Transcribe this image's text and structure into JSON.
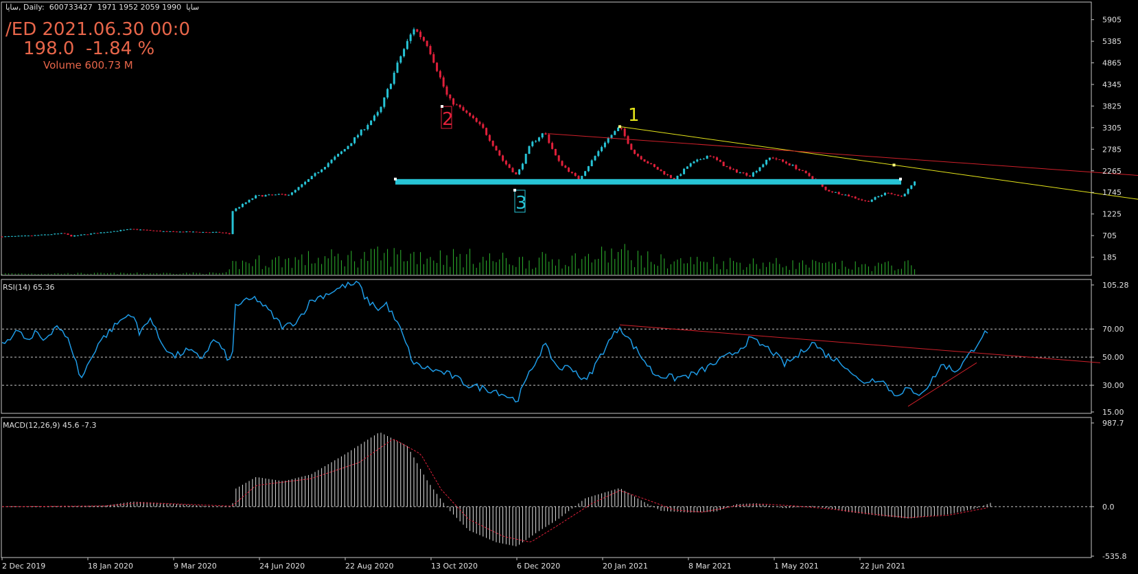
{
  "header": {
    "main_title": "ساپا, Daily:  600733427  1971 1952 2059 1990  ساپا",
    "rsi_title": "RSI(14) 65.36",
    "macd_title": "MACD(12,26,9) 45.6 -7.3"
  },
  "info": {
    "line1": "/ED 2021.06.30 00:0",
    "line2": "198.0  -1.84 %",
    "line3": "Volume 600.73 M"
  },
  "colors": {
    "background": "#000000",
    "frame": "#c8c8c8",
    "bull": "#27c4d6",
    "bear": "#e0203a",
    "volume": "#2fb82f",
    "rsi_line": "#1e9be6",
    "macd_hist": "#e6e6e6",
    "macd_signal": "#e0203a",
    "support": "#27c4d6",
    "trend_yellow": "#e6e61a",
    "trend_red": "#d0202a",
    "label1": "#e6e61a",
    "label2": "#e0203a",
    "label3": "#27c4d6"
  },
  "chart_data": [
    {
      "type": "candlestick",
      "ylim": [
        -120,
        6230
      ],
      "y_ticks": [
        "5905",
        "5385",
        "4865",
        "4345",
        "3825",
        "3305",
        "2785",
        "2265",
        "1745",
        "1225",
        "705",
        "185"
      ],
      "x_ticks": [
        "2 Dec 2019",
        "18 Jan 2020",
        "9 Mar 2020",
        "24 Jun 2020",
        "22 Aug 2020",
        "13 Oct 2020",
        "6 Dec 2020",
        "20 Jan 2021",
        "8 Mar 2021",
        "1 May 2021",
        "22 Jun 2021"
      ],
      "price_path": [
        [
          0,
          680
        ],
        [
          0.04,
          700
        ],
        [
          0.09,
          760
        ],
        [
          0.1,
          690
        ],
        [
          0.15,
          790
        ],
        [
          0.19,
          860
        ],
        [
          0.24,
          800
        ],
        [
          0.29,
          790
        ],
        [
          0.32,
          780
        ],
        [
          0.335,
          730
        ],
        [
          0.335,
          1290
        ],
        [
          0.37,
          1660
        ],
        [
          0.42,
          1700
        ],
        [
          0.45,
          2100
        ],
        [
          0.5,
          2800
        ],
        [
          0.55,
          3700
        ],
        [
          0.58,
          5000
        ],
        [
          0.6,
          5700
        ],
        [
          0.62,
          5300
        ],
        [
          0.65,
          4000
        ],
        [
          0.68,
          3600
        ],
        [
          0.7,
          3300
        ],
        [
          0.73,
          2500
        ],
        [
          0.75,
          2150
        ],
        [
          0.77,
          2900
        ],
        [
          0.79,
          3200
        ],
        [
          0.81,
          2500
        ],
        [
          0.84,
          2050
        ],
        [
          0.88,
          3000
        ],
        [
          0.9,
          3320
        ],
        [
          0.92,
          2700
        ],
        [
          0.95,
          2350
        ],
        [
          0.98,
          2050
        ],
        [
          1.0,
          2400
        ],
        [
          1.03,
          2650
        ],
        [
          1.06,
          2300
        ],
        [
          1.09,
          2150
        ],
        [
          1.12,
          2600
        ],
        [
          1.15,
          2400
        ],
        [
          1.18,
          2100
        ],
        [
          1.2,
          1800
        ],
        [
          1.23,
          1680
        ],
        [
          1.26,
          1520
        ],
        [
          1.29,
          1750
        ],
        [
          1.31,
          1640
        ],
        [
          1.33,
          1990
        ]
      ],
      "volume_path": [
        [
          0,
          20
        ],
        [
          0.33,
          30
        ],
        [
          0.335,
          180
        ],
        [
          0.36,
          240
        ],
        [
          0.45,
          300
        ],
        [
          0.55,
          350
        ],
        [
          0.6,
          380
        ],
        [
          0.68,
          320
        ],
        [
          0.75,
          260
        ],
        [
          0.85,
          300
        ],
        [
          0.9,
          420
        ],
        [
          0.95,
          260
        ],
        [
          1.05,
          240
        ],
        [
          1.15,
          200
        ],
        [
          1.25,
          160
        ],
        [
          1.33,
          180
        ]
      ],
      "volume_ymax": 600,
      "support_level": 2000,
      "annotations": [
        {
          "label": "1",
          "color": "yellow"
        },
        {
          "label": "2",
          "color": "red"
        },
        {
          "label": "3",
          "color": "cyan"
        }
      ],
      "trendlines": [
        {
          "name": "yellow",
          "from": [
            0.9,
            3330
          ],
          "to": [
            1.75,
            1360
          ]
        },
        {
          "name": "red",
          "from": [
            0.795,
            3160
          ],
          "to": [
            1.83,
            1950
          ]
        }
      ]
    },
    {
      "type": "line",
      "name": "RSI(14) 65.36",
      "ylim": [
        10,
        105.28
      ],
      "y_ticks": [
        "105.28",
        "70.00",
        "50.00",
        "30.00",
        "15.00"
      ],
      "levels": [
        70,
        50,
        30
      ],
      "series": [
        [
          0,
          58
        ],
        [
          0.02,
          69
        ],
        [
          0.04,
          61
        ],
        [
          0.05,
          68
        ],
        [
          0.06,
          62
        ],
        [
          0.08,
          73
        ],
        [
          0.1,
          59
        ],
        [
          0.115,
          34
        ],
        [
          0.14,
          60
        ],
        [
          0.17,
          75
        ],
        [
          0.19,
          82
        ],
        [
          0.2,
          66
        ],
        [
          0.215,
          79
        ],
        [
          0.23,
          62
        ],
        [
          0.25,
          50
        ],
        [
          0.27,
          55
        ],
        [
          0.29,
          49
        ],
        [
          0.31,
          63
        ],
        [
          0.335,
          45
        ],
        [
          0.34,
          87
        ],
        [
          0.37,
          92
        ],
        [
          0.39,
          82
        ],
        [
          0.41,
          71
        ],
        [
          0.43,
          76
        ],
        [
          0.45,
          90
        ],
        [
          0.5,
          101
        ],
        [
          0.52,
          102
        ],
        [
          0.53,
          91
        ],
        [
          0.55,
          84
        ],
        [
          0.56,
          88
        ],
        [
          0.58,
          70
        ],
        [
          0.6,
          45
        ],
        [
          0.62,
          42
        ],
        [
          0.65,
          38
        ],
        [
          0.68,
          30
        ],
        [
          0.72,
          26
        ],
        [
          0.75,
          19
        ],
        [
          0.77,
          40
        ],
        [
          0.79,
          59
        ],
        [
          0.81,
          42
        ],
        [
          0.83,
          43
        ],
        [
          0.85,
          32
        ],
        [
          0.88,
          58
        ],
        [
          0.9,
          72
        ],
        [
          0.92,
          58
        ],
        [
          0.95,
          38
        ],
        [
          0.98,
          35
        ],
        [
          1.01,
          38
        ],
        [
          1.04,
          46
        ],
        [
          1.07,
          54
        ],
        [
          1.09,
          63
        ],
        [
          1.12,
          55
        ],
        [
          1.14,
          45
        ],
        [
          1.16,
          51
        ],
        [
          1.18,
          61
        ],
        [
          1.2,
          52
        ],
        [
          1.23,
          44
        ],
        [
          1.25,
          32
        ],
        [
          1.28,
          35
        ],
        [
          1.3,
          23
        ],
        [
          1.32,
          28
        ],
        [
          1.33,
          22
        ],
        [
          1.35,
          30
        ],
        [
          1.37,
          45
        ],
        [
          1.39,
          40
        ],
        [
          1.41,
          52
        ],
        [
          1.43,
          67
        ],
        [
          1.44,
          65
        ]
      ],
      "trendlines": [
        {
          "name": "red-down",
          "from": [
            0.9,
            73
          ],
          "to": [
            1.6,
            46
          ]
        },
        {
          "name": "red-up",
          "from": [
            1.32,
            15
          ],
          "to": [
            1.42,
            46
          ]
        }
      ]
    },
    {
      "type": "bar",
      "name": "MACD(12,26,9) 45.6 -7.3",
      "ylim": [
        -535.8,
        987.7
      ],
      "y_ticks": [
        "987.7",
        "0.0",
        "-535.8"
      ],
      "histogram_path": [
        [
          0,
          0
        ],
        [
          0.15,
          10
        ],
        [
          0.19,
          60
        ],
        [
          0.24,
          40
        ],
        [
          0.3,
          5
        ],
        [
          0.335,
          0
        ],
        [
          0.34,
          210
        ],
        [
          0.37,
          350
        ],
        [
          0.41,
          300
        ],
        [
          0.45,
          380
        ],
        [
          0.5,
          620
        ],
        [
          0.55,
          880
        ],
        [
          0.59,
          720
        ],
        [
          0.62,
          300
        ],
        [
          0.65,
          -30
        ],
        [
          0.68,
          -280
        ],
        [
          0.72,
          -420
        ],
        [
          0.75,
          -470
        ],
        [
          0.78,
          -300
        ],
        [
          0.81,
          -150
        ],
        [
          0.85,
          100
        ],
        [
          0.9,
          220
        ],
        [
          0.93,
          80
        ],
        [
          0.96,
          -50
        ],
        [
          1.0,
          -70
        ],
        [
          1.04,
          -60
        ],
        [
          1.07,
          30
        ],
        [
          1.1,
          40
        ],
        [
          1.14,
          -20
        ],
        [
          1.18,
          10
        ],
        [
          1.23,
          -60
        ],
        [
          1.28,
          -110
        ],
        [
          1.32,
          -140
        ],
        [
          1.38,
          -90
        ],
        [
          1.42,
          -20
        ],
        [
          1.44,
          45
        ]
      ],
      "signal_path": [
        [
          0,
          0
        ],
        [
          0.15,
          8
        ],
        [
          0.2,
          45
        ],
        [
          0.26,
          30
        ],
        [
          0.335,
          5
        ],
        [
          0.37,
          250
        ],
        [
          0.45,
          330
        ],
        [
          0.52,
          520
        ],
        [
          0.57,
          800
        ],
        [
          0.61,
          620
        ],
        [
          0.64,
          200
        ],
        [
          0.68,
          -150
        ],
        [
          0.73,
          -350
        ],
        [
          0.77,
          -420
        ],
        [
          0.81,
          -220
        ],
        [
          0.86,
          40
        ],
        [
          0.9,
          190
        ],
        [
          0.94,
          80
        ],
        [
          0.98,
          -40
        ],
        [
          1.02,
          -65
        ],
        [
          1.07,
          10
        ],
        [
          1.11,
          30
        ],
        [
          1.16,
          5
        ],
        [
          1.21,
          -30
        ],
        [
          1.27,
          -90
        ],
        [
          1.32,
          -130
        ],
        [
          1.38,
          -100
        ],
        [
          1.44,
          -7
        ]
      ]
    }
  ]
}
